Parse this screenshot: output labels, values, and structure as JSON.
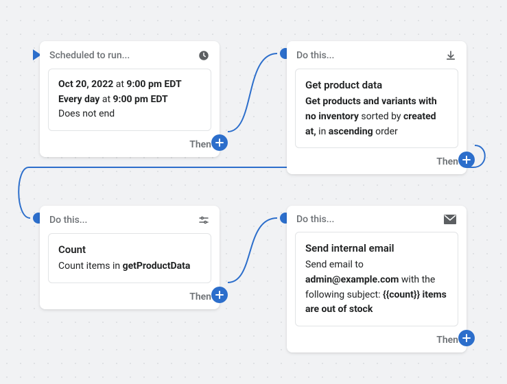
{
  "cards": {
    "schedule": {
      "header": "Scheduled to run...",
      "date_label": "Oct 20, 2022",
      "at1": " at ",
      "time1": "9:00 pm EDT",
      "every": "Every day",
      "at2": " at ",
      "time2": "9:00 pm EDT",
      "does_not_end": "Does not end",
      "then": "Then"
    },
    "get_product": {
      "header": "Do this...",
      "title": "Get product data",
      "line1a": "Get products and variants with no inventory",
      "line1b": " sorted by ",
      "line1c": "created at,",
      "line2a": " in ",
      "line2b": "ascending",
      "line2c": " order",
      "then": "Then"
    },
    "count": {
      "header": "Do this...",
      "title": "Count",
      "desc_prefix": "Count items in ",
      "desc_bold": "getProductData",
      "then": "Then"
    },
    "email": {
      "header": "Do this...",
      "title": "Send internal email",
      "l1": "Send email to ",
      "l2": "admin@example.com",
      "l3": " with the following subject: ",
      "l4": "{{count}} items are out of stock",
      "then": "Then"
    }
  }
}
